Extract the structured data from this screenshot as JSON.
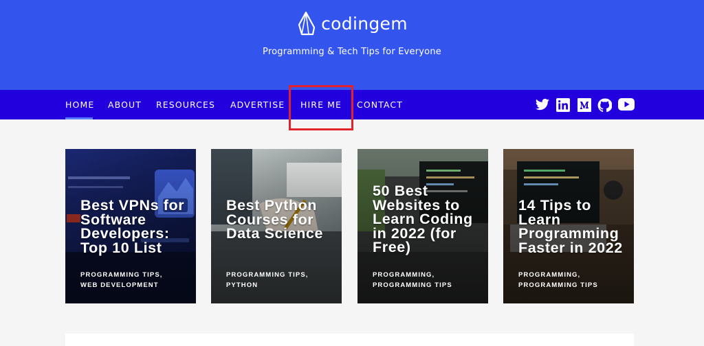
{
  "site": {
    "logo_text": "codingem",
    "tagline": "Programming & Tech Tips for Everyone"
  },
  "nav": {
    "items": [
      {
        "label": "HOME",
        "active": true
      },
      {
        "label": "ABOUT"
      },
      {
        "label": "RESOURCES"
      },
      {
        "label": "ADVERTISE"
      },
      {
        "label": "HIRE ME",
        "highlighted": true
      },
      {
        "label": "CONTACT"
      }
    ]
  },
  "social": [
    "twitter-icon",
    "linkedin-icon",
    "medium-icon",
    "github-icon",
    "youtube-icon"
  ],
  "colors": {
    "header": "#3355ee",
    "nav": "#2200dd",
    "highlight_box": "#e3232c",
    "page_bg": "#f5f5f5"
  },
  "cards": [
    {
      "title": "Best VPNs for Software Developers: Top 10 List",
      "categories": [
        "PROGRAMMING TIPS,",
        "WEB DEVELOPMENT"
      ]
    },
    {
      "title": "Best Python Courses for Data Science",
      "categories": [
        "PROGRAMMING TIPS,",
        "PYTHON"
      ]
    },
    {
      "title": "50 Best Websites to Learn Coding in 2022 (for Free)",
      "categories": [
        "PROGRAMMING,",
        "PROGRAMMING TIPS"
      ]
    },
    {
      "title": "14 Tips to Learn Programming Faster in 2022",
      "categories": [
        "PROGRAMMING,",
        "PROGRAMMING TIPS"
      ]
    }
  ]
}
